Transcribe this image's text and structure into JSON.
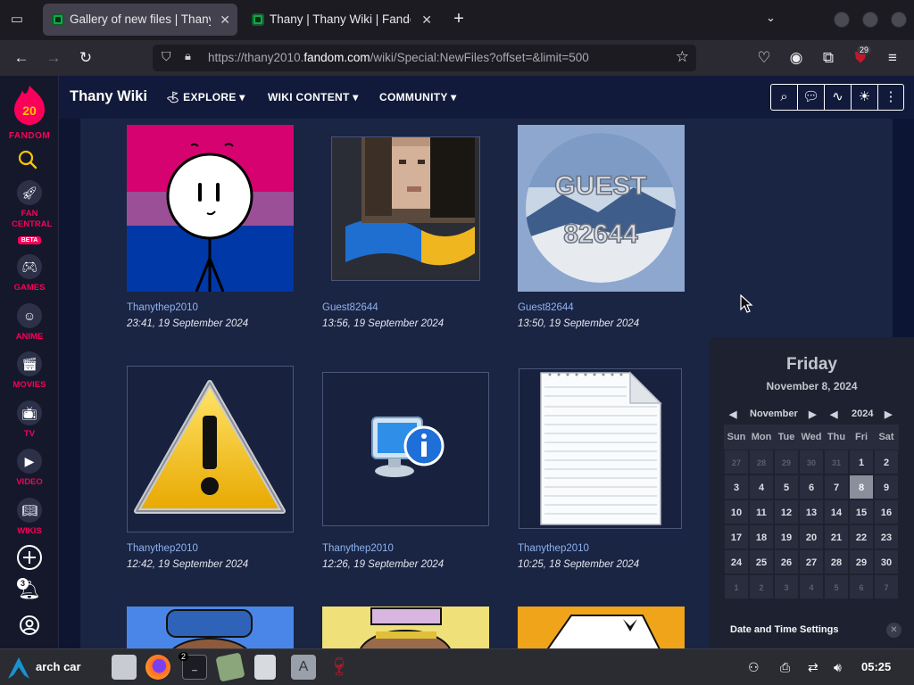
{
  "browser": {
    "tabs": [
      {
        "title": "Gallery of new files | Thany W",
        "active": true
      },
      {
        "title": "Thany | Thany Wiki | Fandom",
        "active": false
      }
    ],
    "url_prefix": "https://thany2010.",
    "url_host": "fandom.com",
    "url_path": "/wiki/Special:NewFiles?offset=&limit=500",
    "extension_badge": "29"
  },
  "rail": {
    "logo_number": "20",
    "brand": "FANDOM",
    "items": [
      {
        "label": "FAN CENTRAL",
        "badge": "BETA",
        "icon": "rocket-icon"
      },
      {
        "label": "GAMES",
        "icon": "gamepad-icon"
      },
      {
        "label": "ANIME",
        "icon": "anime-face-icon"
      },
      {
        "label": "MOVIES",
        "icon": "clapperboard-icon"
      },
      {
        "label": "TV",
        "icon": "tv-icon"
      },
      {
        "label": "VIDEO",
        "icon": "play-icon"
      },
      {
        "label": "WIKIS",
        "icon": "book-icon"
      }
    ],
    "notification_count": "3"
  },
  "wiki": {
    "name": "Thany Wiki",
    "menus": [
      "EXPLORE",
      "WIKI CONTENT",
      "COMMUNITY"
    ]
  },
  "gallery": {
    "files": [
      {
        "user": "Thanythep2010",
        "date": "23:41, 19 September 2024"
      },
      {
        "user": "Guest82644",
        "date": "13:56, 19 September 2024"
      },
      {
        "user": "Guest82644",
        "date": "13:50, 19 September 2024"
      },
      {
        "user": "Thanythep2010",
        "date": "12:42, 19 September 2024"
      },
      {
        "user": "Thanythep2010",
        "date": "12:26, 19 September 2024"
      },
      {
        "user": "Thanythep2010",
        "date": "10:25, 18 September 2024"
      }
    ],
    "guest_image_text": [
      "GUEST",
      "82644"
    ]
  },
  "calendar": {
    "weekday": "Friday",
    "full_date": "November 8, 2024",
    "month": "November",
    "year": "2024",
    "headers": [
      "Sun",
      "Mon",
      "Tue",
      "Wed",
      "Thu",
      "Fri",
      "Sat"
    ],
    "weeks": [
      [
        "27",
        "28",
        "29",
        "30",
        "31",
        "1",
        "2"
      ],
      [
        "3",
        "4",
        "5",
        "6",
        "7",
        "8",
        "9"
      ],
      [
        "10",
        "11",
        "12",
        "13",
        "14",
        "15",
        "16"
      ],
      [
        "17",
        "18",
        "19",
        "20",
        "21",
        "22",
        "23"
      ],
      [
        "24",
        "25",
        "26",
        "27",
        "28",
        "29",
        "30"
      ],
      [
        "1",
        "2",
        "3",
        "4",
        "5",
        "6",
        "7"
      ]
    ],
    "settings_label": "Date and Time Settings"
  },
  "taskbar": {
    "start_label": "arch car",
    "terminal_badge": "2",
    "clock": "05:25"
  }
}
